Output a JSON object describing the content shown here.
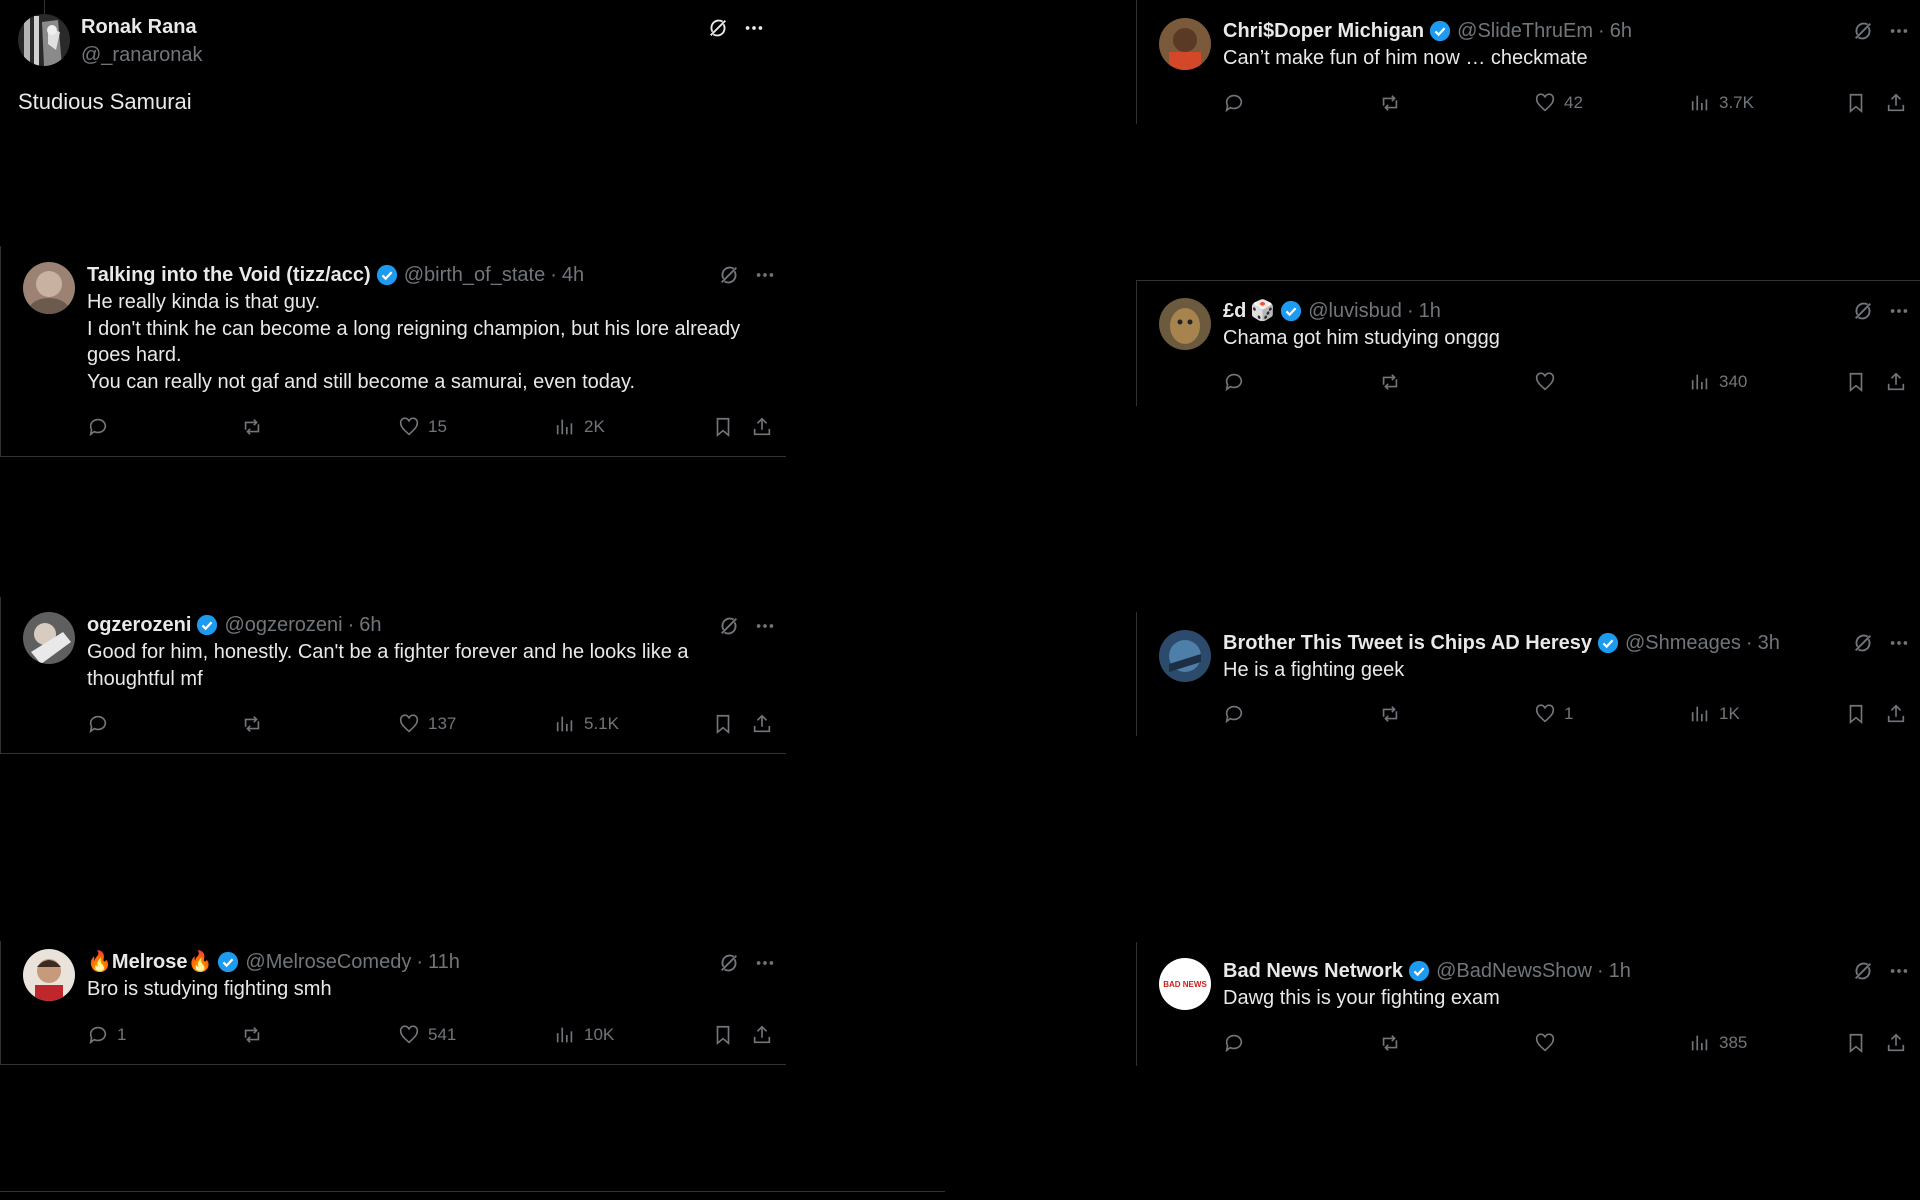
{
  "colors": {
    "background": "#000000",
    "text": "#e7e9ea",
    "muted": "#71767b",
    "verified": "#1d9bf0",
    "divider": "#2f3336"
  },
  "main_post": {
    "name": "Ronak Rana",
    "handle": "@_ranaronak",
    "text": "Studious Samurai",
    "icons": [
      "grok-icon",
      "more-icon"
    ]
  },
  "left_replies": [
    {
      "name": "Talking into the Void (tizz/acc)",
      "verified": true,
      "handle": "@birth_of_state",
      "time": "4h",
      "lines": [
        "He really kinda is that guy.",
        "I don't think he can become a long reigning champion, but his lore already",
        "goes hard.",
        "You can really not gaf and still become a samurai, even today."
      ],
      "replies": "",
      "reposts": "",
      "likes": "15",
      "views": "2K"
    },
    {
      "name": "ogzerozeni",
      "verified": true,
      "handle": "@ogzerozeni",
      "time": "6h",
      "lines": [
        "Good for him, honestly. Can't be a fighter forever and he looks like a",
        "thoughtful mf"
      ],
      "replies": "",
      "reposts": "",
      "likes": "137",
      "views": "5.1K"
    },
    {
      "name_prefix": "🔥",
      "name": "Melrose",
      "name_suffix": "🔥",
      "verified": true,
      "handle": "@MelroseComedy",
      "time": "11h",
      "lines": [
        "Bro is studying fighting smh"
      ],
      "replies": "1",
      "reposts": "",
      "likes": "541",
      "views": "10K"
    }
  ],
  "right_replies": [
    {
      "name": "Chri$Doper Michigan",
      "verified": true,
      "handle": "@SlideThruEm",
      "time": "6h",
      "lines": [
        "Can’t make fun of him now … checkmate"
      ],
      "replies": "",
      "reposts": "",
      "likes": "42",
      "views": "3.7K"
    },
    {
      "name": "£d",
      "name_suffix": "🎲",
      "verified": true,
      "handle": "@luvisbud",
      "time": "1h",
      "lines": [
        "Chama got him studying onggg"
      ],
      "replies": "",
      "reposts": "",
      "likes": "",
      "views": "340"
    },
    {
      "name": "Brother This Tweet is Chips AD Heresy",
      "verified": true,
      "handle": "@Shmeages",
      "time": "3h",
      "lines": [
        "He is a fighting geek"
      ],
      "replies": "",
      "reposts": "",
      "likes": "1",
      "views": "1K"
    },
    {
      "name": "Bad News Network",
      "verified": true,
      "handle": "@BadNewsShow",
      "time": "1h",
      "lines": [
        "Dawg this is your fighting exam"
      ],
      "replies": "",
      "reposts": "",
      "likes": "",
      "views": "385",
      "avatar_text": "BAD NEWS"
    }
  ]
}
